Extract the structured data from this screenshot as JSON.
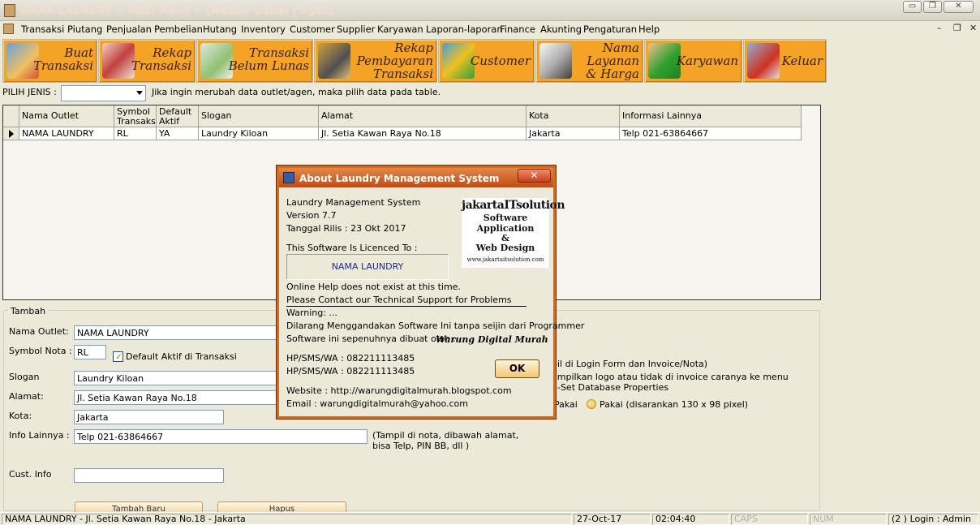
{
  "window": {
    "title": "NAMA LAUNDRY  --  Main Menu  --  [Master Outlet / Agen]",
    "controls": {
      "minimize": "▭",
      "restore": "❐",
      "close": "✕"
    }
  },
  "menu": {
    "items": [
      "Transaksi",
      "Piutang",
      "Penjualan",
      "Pembelian",
      "Hutang",
      "Inventory",
      "Customer",
      "Supplier",
      "Karyawan",
      "Laporan-laporan",
      "Finance",
      "Akunting",
      "Pengaturan",
      "Help"
    ],
    "mdi_controls": {
      "minimize": "–",
      "restore": "❐",
      "close": "✕"
    }
  },
  "toolbar": {
    "buttons": [
      {
        "label": "Buat\nTransaksi",
        "icon": "laundry-basket-icon"
      },
      {
        "label": "Rekap\nTransaksi",
        "icon": "laundry-rack-icon"
      },
      {
        "label": "Transaksi\nBelum Lunas",
        "icon": "calculator-icon"
      },
      {
        "label": "Rekap\nPembayaran\nTransaksi",
        "icon": "card-terminal-icon"
      },
      {
        "label": "Customer",
        "icon": "customers-icon"
      },
      {
        "label": "Nama\nLayanan\n& Harga",
        "icon": "tshirt-icon"
      },
      {
        "label": "Karyawan",
        "icon": "employee-icon"
      },
      {
        "label": "Keluar",
        "icon": "exit-icon"
      }
    ]
  },
  "filter": {
    "label": "PILIH JENIS :",
    "selected": "",
    "hint": "Jika ingin merubah data outlet/agen, maka pilih data pada table."
  },
  "grid": {
    "headers": [
      "Nama Outlet",
      "Symbol\nTransaksi",
      "Default\nAktif",
      "Slogan",
      "Alamat",
      "Kota",
      "Informasi Lainnya"
    ],
    "rows": [
      [
        "NAMA LAUNDRY",
        "RL",
        "YA",
        "Laundry Kiloan",
        "Jl. Setia Kawan Raya No.18",
        "Jakarta",
        "Telp 021-63864667"
      ]
    ]
  },
  "form": {
    "legend": "Tambah",
    "nama_outlet_label": "Nama Outlet:",
    "nama_outlet_value": "NAMA LAUNDRY",
    "symbol_label": "Symbol Nota :",
    "symbol_value": "RL",
    "default_aktif_label": "Default Aktif di Transaksi",
    "slogan_label": "Slogan",
    "slogan_value": "Laundry Kiloan",
    "alamat_label": "Alamat:",
    "alamat_value": "Jl. Setia Kawan Raya No.18",
    "kota_label": "Kota:",
    "kota_value": "Jakarta",
    "info_label": "Info Lainnya :",
    "info_value": "Telp 021-63864667",
    "info_note": "(Tampil di nota, dibawah alamat,\nbisa Telp, PIN BB, dll )",
    "cust_info_label": "Cust. Info",
    "cust_info_value": "",
    "right_note_1": "pil di Login Form dan Invoice/Nota)",
    "right_note_2": "ampilkan logo atau tidak di invoice caranya ke menu",
    "right_note_3": "n-Set Database Properties",
    "radio_1": "Pakai",
    "radio_2": "Pakai (disarankan 130 x 98 pixel)",
    "btn_tambah": "Tambah Baru",
    "btn_hapus": "Hapus"
  },
  "status": {
    "outlet": "NAMA LAUNDRY - Jl. Setia Kawan Raya No.18 - Jakarta",
    "date": "27-Oct-17",
    "time": "02:04:40",
    "caps": "CAPS",
    "num": "NUM",
    "login": "(2 ) Login : Admin"
  },
  "dialog": {
    "title": "About Laundry Management System",
    "close": "✕",
    "app_name": "Laundry Management System",
    "version": "Version 7.7",
    "release": "Tanggal Rilis : 23 Okt 2017",
    "licenced_to_label": "This Software Is Licenced To :",
    "licenced_to": "NAMA LAUNDRY",
    "help_line_1": "Online Help does not exist at this time.",
    "help_line_2": "Please Contact our Technical Support for Problems",
    "warning": "Warning: ...",
    "warning_text": "Dilarang Menggandakan Software Ini tanpa seijin dari Programmer",
    "made_by_label": "Software ini sepenuhnya dibuat oleh :",
    "made_by": "Warung Digital Murah",
    "phone_1": "HP/SMS/WA : 082211113485",
    "phone_2": "HP/SMS/WA : 082211113485",
    "website": "Website : http://warungdigitalmurah.blogspot.com",
    "email": "Email : warungdigitalmurah@yahoo.com",
    "ok": "OK",
    "logo": {
      "line1": "jakartaITsolution",
      "line2": "Software Application",
      "line3": "&",
      "line4": "Web Design",
      "line5": "www.jakartaitsolution.com"
    }
  }
}
